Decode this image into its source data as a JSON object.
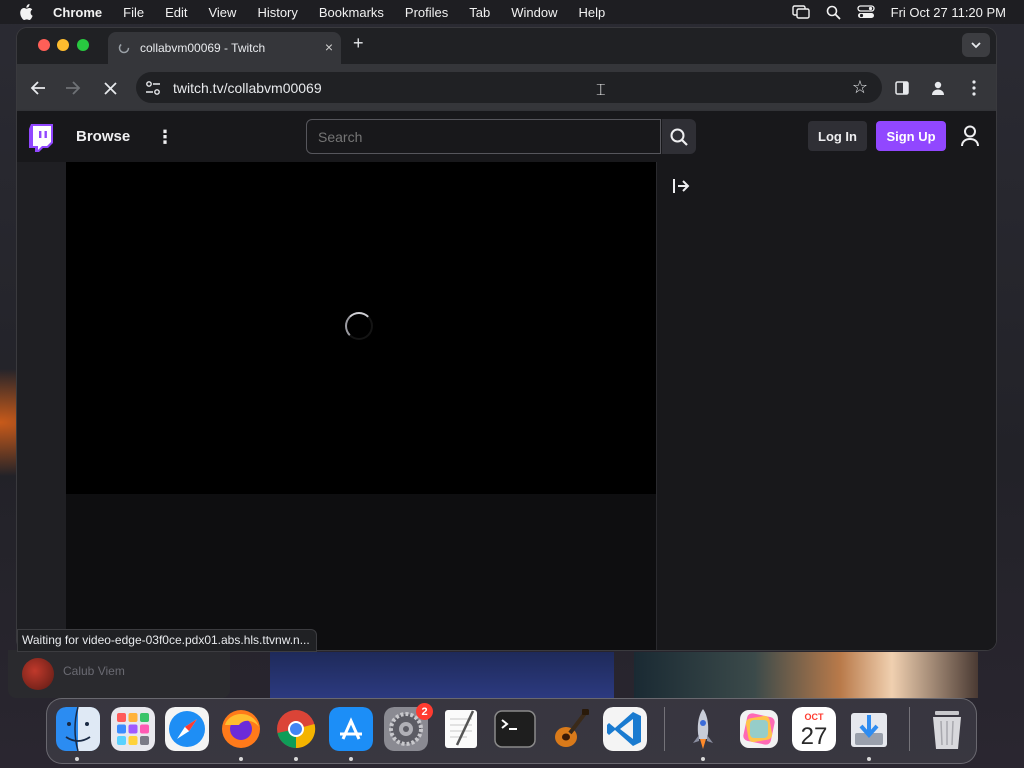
{
  "menubar": {
    "app_name": "Chrome",
    "items": [
      "File",
      "Edit",
      "View",
      "History",
      "Bookmarks",
      "Profiles",
      "Tab",
      "Window",
      "Help"
    ],
    "clock": "Fri Oct 27  11:20 PM"
  },
  "browser": {
    "tab_title": "collabvm00069 - Twitch",
    "tab_close": "×",
    "new_tab": "+",
    "url": "twitch.tv/collabvm00069",
    "status_text": "Waiting for video-edge-03f0ce.pdx01.abs.hls.ttvnw.n..."
  },
  "twitch": {
    "browse_label": "Browse",
    "more_label": "⋮",
    "search_placeholder": "Search",
    "login_label": "Log In",
    "signup_label": "Sign Up",
    "accent": "#9147ff"
  },
  "background": {
    "window_label": "Calub Viem"
  },
  "dock": {
    "apps": [
      "finder",
      "launchpad",
      "safari",
      "firefox",
      "chrome",
      "app-store",
      "system-settings",
      "textedit",
      "terminal",
      "garageband",
      "vscode",
      "rocket-typist",
      "pixelmator",
      "calendar",
      "downloads",
      "trash"
    ],
    "calendar_month": "OCT",
    "calendar_day": "27",
    "settings_badge": "2"
  }
}
